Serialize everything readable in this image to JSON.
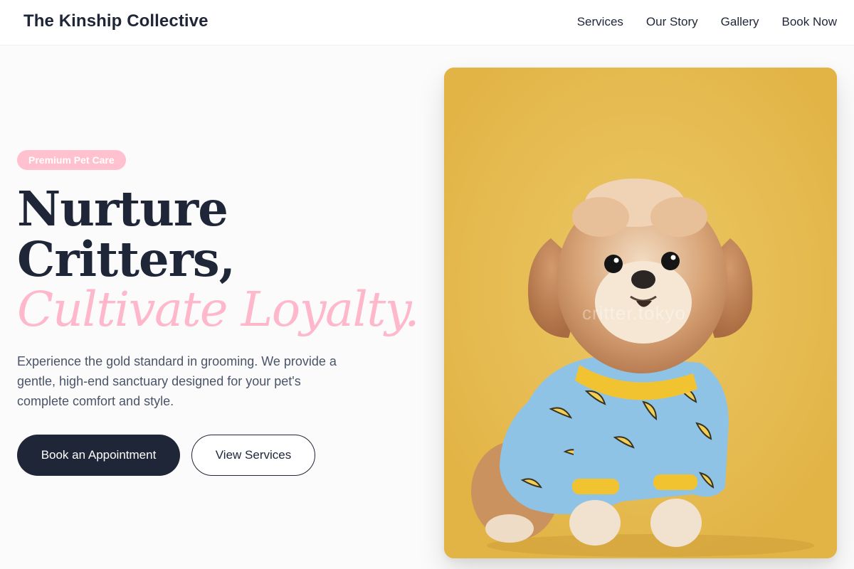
{
  "brand": "The Kinship Collective",
  "nav": {
    "links": [
      "Services",
      "Our Story",
      "Gallery",
      "Book Now"
    ]
  },
  "hero": {
    "badge": "Premium Pet Care",
    "headline": {
      "line1": "Nurture",
      "line2": "Critters,",
      "accent": "Cultivate Loyalty."
    },
    "lead": "Experience the gold standard in grooming. We provide a gentle, high-end sanctuary designed for your pet's complete comfort and style.",
    "primary_button": "Book an Appointment",
    "secondary_button": "View Services",
    "photo_watermark": "critter.tokyo"
  },
  "colors": {
    "navy": "#1e2638",
    "pink_accent": "#ffb8cb",
    "photo_background": "#e8bf52"
  }
}
